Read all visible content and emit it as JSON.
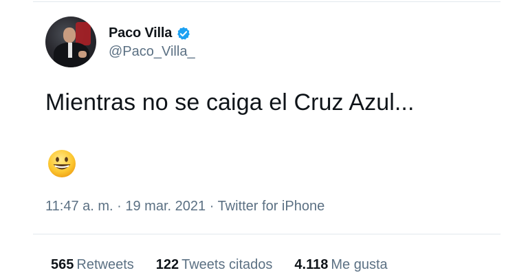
{
  "user": {
    "display_name": "Paco Villa",
    "handle": "@Paco_Villa_",
    "verified_icon": "verified-badge-icon",
    "verified_color": "#1da1f2"
  },
  "tweet": {
    "text": "Mientras no se caiga el Cruz Azul...",
    "emoji": "grinning-face-emoji",
    "time": "11:47 a. m.",
    "date": "19 mar. 2021",
    "source": "Twitter for iPhone",
    "separator": "·"
  },
  "stats": [
    {
      "count": "565",
      "label": "Retweets"
    },
    {
      "count": "122",
      "label": "Tweets citados"
    },
    {
      "count": "4.118",
      "label": "Me gusta"
    }
  ]
}
